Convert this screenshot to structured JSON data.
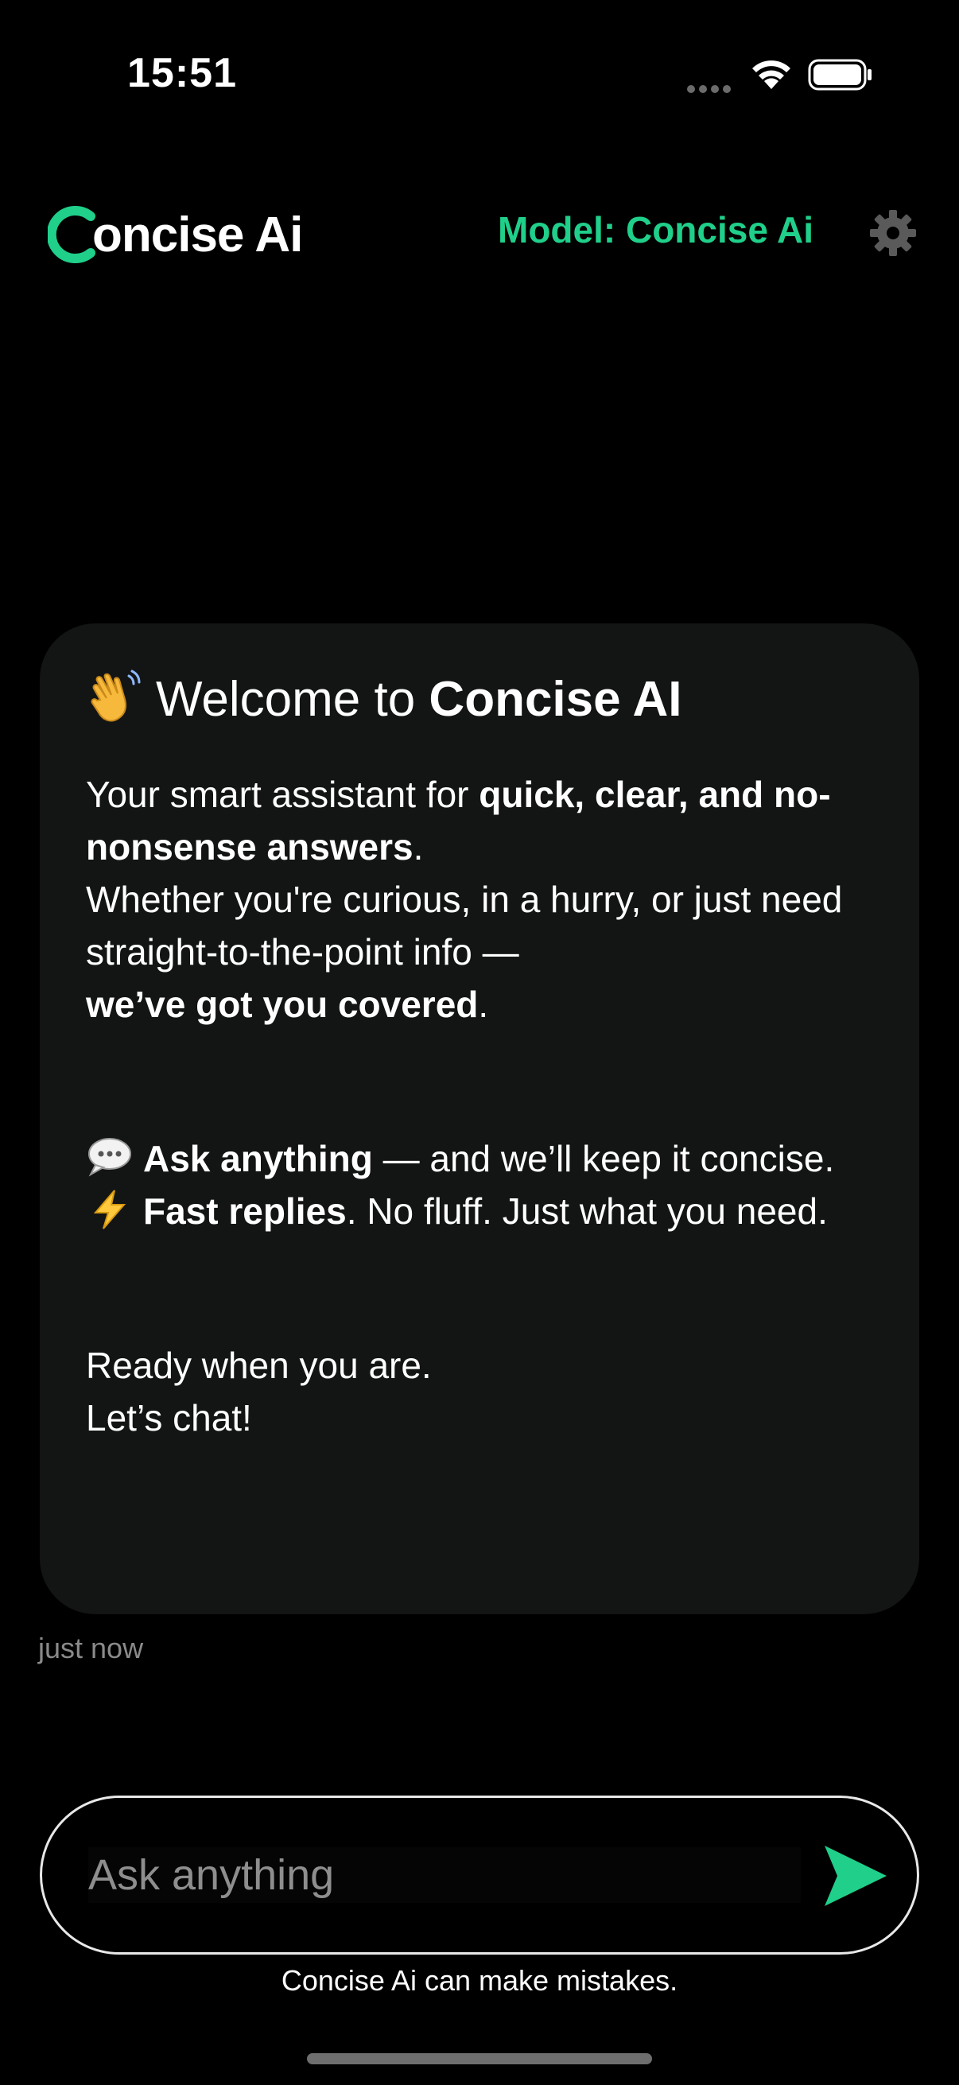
{
  "status_bar": {
    "time": "15:51"
  },
  "header": {
    "logo_text": "oncise Ai",
    "model_label": "Model: Concise Ai"
  },
  "welcome": {
    "title_prefix": "Welcome to ",
    "title_bold": "Concise AI",
    "intro_1": "Your smart assistant for ",
    "intro_1_bold": "quick, clear, and no-nonsense answers",
    "intro_1_end": ".",
    "intro_2": "Whether you're curious, in a hurry, or just need straight-to-the-point info —",
    "intro_3_bold": "we’ve got you covered",
    "intro_3_end": ".",
    "feature_1_bold": "Ask anything",
    "feature_1_rest": " — and we’ll keep it concise.",
    "feature_2_bold": "Fast replies",
    "feature_2_rest": ". No fluff. Just what you need.",
    "closing_1": "Ready when you are.",
    "closing_2": "Let’s chat!"
  },
  "message_meta": {
    "timestamp": "just now"
  },
  "composer": {
    "placeholder": "Ask anything",
    "value": ""
  },
  "footer": {
    "disclaimer": "Concise Ai can make mistakes."
  },
  "colors": {
    "accent": "#1fcf8a",
    "background": "#000000",
    "card": "#131515"
  },
  "icons": {
    "wave": "waving-hand-icon",
    "chat": "speech-bubble-icon",
    "bolt": "lightning-icon",
    "settings": "gear-icon",
    "send": "send-icon"
  }
}
